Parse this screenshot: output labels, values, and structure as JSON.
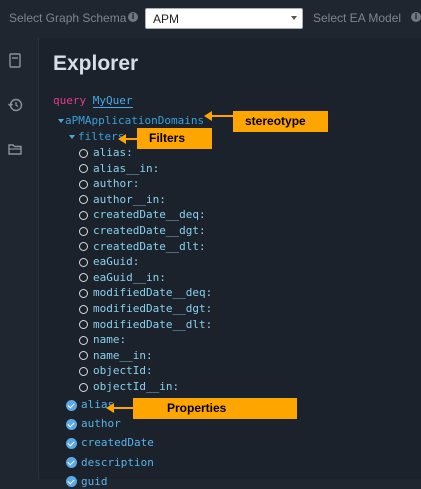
{
  "toolbar": {
    "schema_label": "Select Graph Schema",
    "schema_value": "APM",
    "ea_model_label": "Select EA Model"
  },
  "explorer": {
    "title": "Explorer",
    "query_keyword": "query",
    "query_name": "MyQuer",
    "root_field": "aPMApplicationDomains",
    "filters_field": "filters",
    "filter_args": [
      "alias:",
      "alias__in:",
      "author:",
      "author__in:",
      "createdDate__deq:",
      "createdDate__dgt:",
      "createdDate__dlt:",
      "eaGuid:",
      "eaGuid__in:",
      "modifiedDate__deq:",
      "modifiedDate__dgt:",
      "modifiedDate__dlt:",
      "name:",
      "name__in:",
      "objectId:",
      "objectId__in:"
    ],
    "properties": [
      "alias",
      "author",
      "createdDate",
      "description",
      "guid"
    ]
  },
  "callouts": {
    "stereotype": "stereotype",
    "filters": "Filters",
    "properties": "Properties"
  },
  "colors": {
    "callout": "#ffa500",
    "accent": "#49a8e6",
    "keyword": "#e23d8e"
  }
}
